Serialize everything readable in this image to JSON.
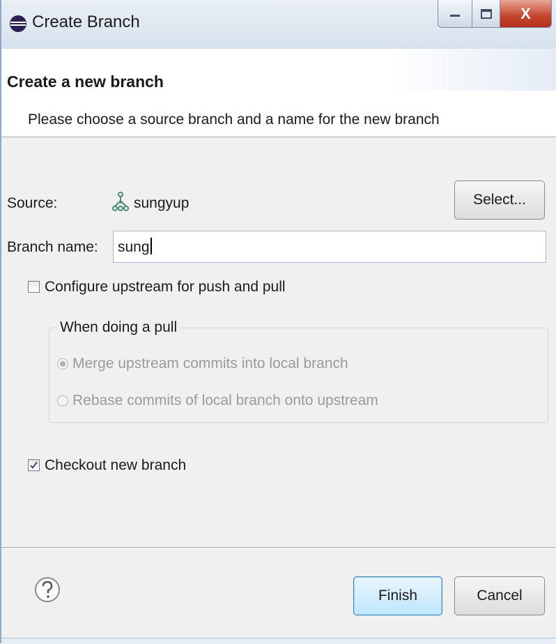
{
  "window": {
    "title": "Create Branch",
    "close_glyph": "X",
    "colors": {
      "titlebar": "#d8e2ee",
      "close": "#c4442d",
      "accent": "#3c7fb1"
    }
  },
  "header": {
    "title": "Create a new branch",
    "description": "Please choose a source branch and a name for the new branch"
  },
  "source": {
    "label": "Source:",
    "value": "sungyup",
    "icon": "branch-icon",
    "select_label": "Select..."
  },
  "branch_name": {
    "label": "Branch name:",
    "value": "sung"
  },
  "upstream": {
    "label": "Configure upstream for push and pull",
    "checked": false
  },
  "pull_group": {
    "title": "When doing a pull",
    "options": [
      {
        "label": "Merge upstream commits into local branch",
        "selected": true,
        "enabled": false
      },
      {
        "label": "Rebase commits of local branch onto upstream",
        "selected": false,
        "enabled": false
      }
    ]
  },
  "checkout": {
    "label": "Checkout new branch",
    "checked": true
  },
  "footer": {
    "help_icon": "help-icon",
    "finish_label": "Finish",
    "cancel_label": "Cancel"
  }
}
